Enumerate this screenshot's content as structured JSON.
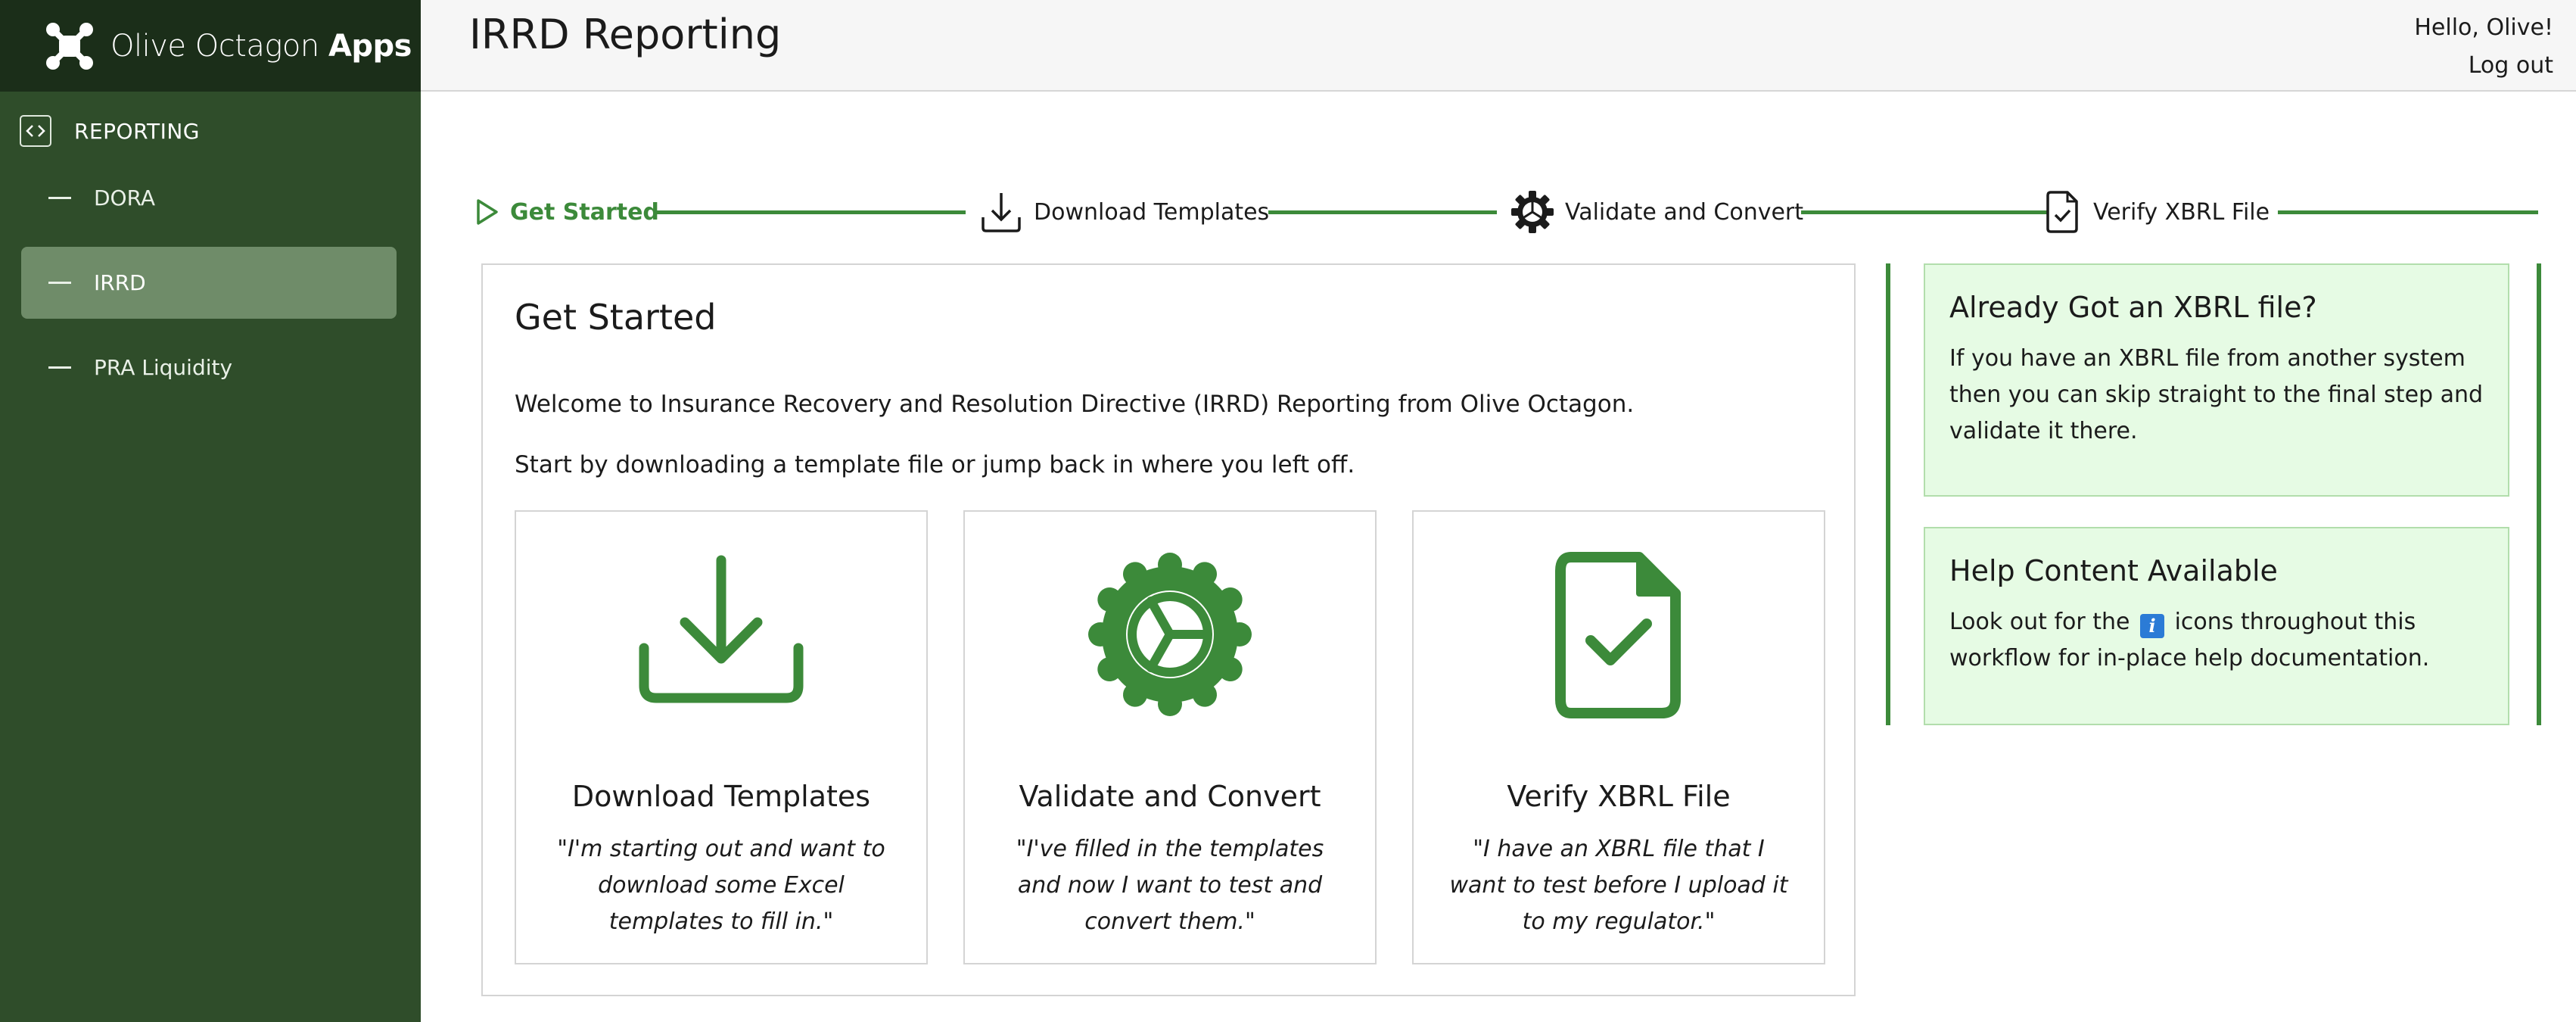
{
  "app": {
    "brand_light": "Olive Octagon",
    "brand_bold": "Apps"
  },
  "sidebar": {
    "section_label": "REPORTING",
    "items": [
      {
        "label": "DORA",
        "active": false
      },
      {
        "label": "IRRD",
        "active": true
      },
      {
        "label": "PRA Liquidity",
        "active": false
      }
    ]
  },
  "header": {
    "title": "IRRD Reporting",
    "greeting": "Hello, Olive!",
    "logout": "Log out"
  },
  "stepper": {
    "steps": [
      {
        "label": "Get Started",
        "icon": "play-icon",
        "active": true
      },
      {
        "label": "Download Templates",
        "icon": "download-icon",
        "active": false
      },
      {
        "label": "Validate and Convert",
        "icon": "gear-icon",
        "active": false
      },
      {
        "label": "Verify XBRL File",
        "icon": "file-check-icon",
        "active": false
      }
    ]
  },
  "main": {
    "title": "Get Started",
    "intro1": "Welcome to Insurance Recovery and Resolution Directive (IRRD) Reporting from Olive Octagon.",
    "intro2": "Start by downloading a template file or jump back in where you left off.",
    "cards": [
      {
        "title": "Download Templates",
        "quote": "\"I'm starting out and want to download some Excel templates to fill in.\"",
        "icon": "download-icon"
      },
      {
        "title": "Validate and Convert",
        "quote": "\"I've filled in the templates and now I want to test and convert them.\"",
        "icon": "gear-icon"
      },
      {
        "title": "Verify XBRL File",
        "quote": "\"I have an XBRL file that I want to test before I upload it to my regulator.\"",
        "icon": "file-check-icon"
      }
    ]
  },
  "side": {
    "box1": {
      "title": "Already Got an XBRL file?",
      "text": "If you have an XBRL file from another system then you can skip straight to the final step and validate it there."
    },
    "box2": {
      "title": "Help Content Available",
      "text_before": "Look out for the",
      "icon_glyph": "i",
      "text_after": "icons throughout this workflow for in-place help documentation."
    }
  },
  "colors": {
    "sidebar": "#2f4d2a",
    "brand_bar": "#1b2e19",
    "accent_green": "#3c8a3a",
    "active_nav": "#6f8c69",
    "info_bg": "#e6fbe4",
    "info_icon": "#2b7bd6"
  }
}
